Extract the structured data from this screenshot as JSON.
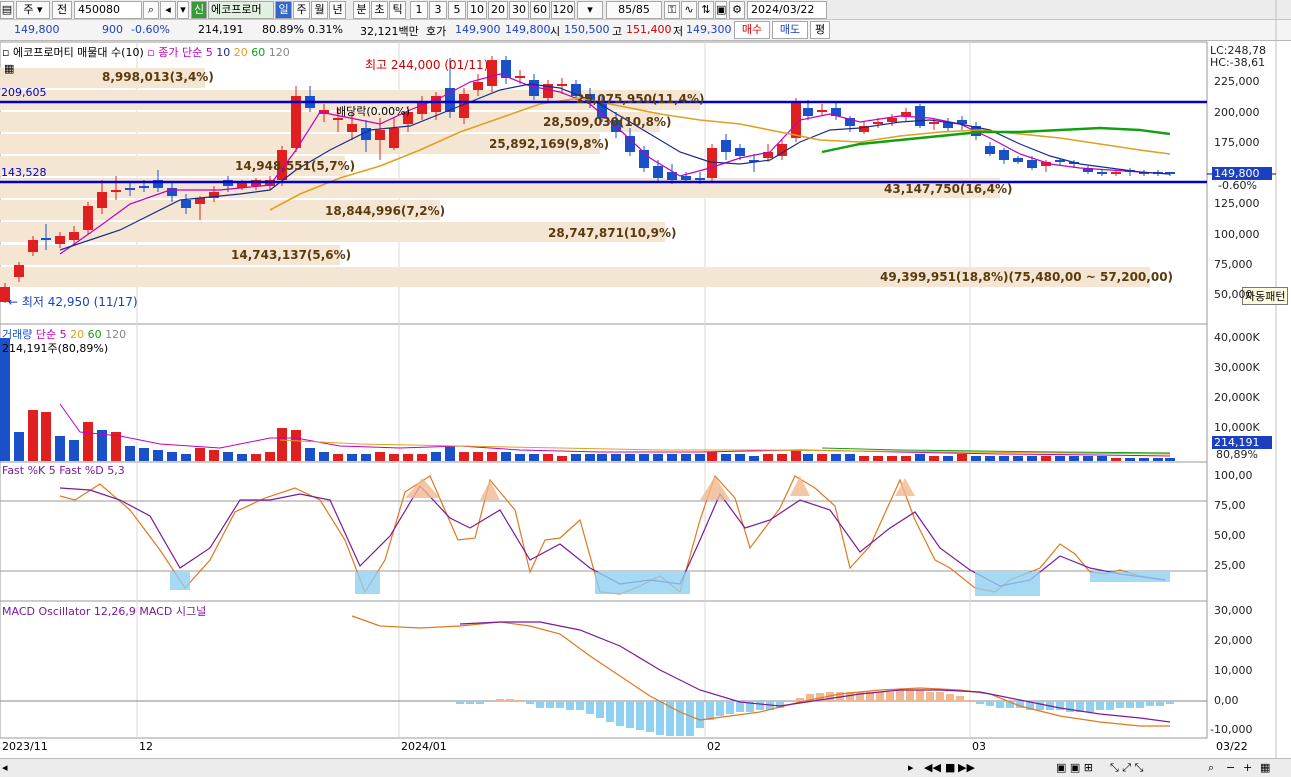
{
  "toolbar": {
    "type_select": "주",
    "side_select": "전",
    "code": "450080",
    "new_badge": "신",
    "stock_name": "에코프로머",
    "periods": [
      "일",
      "주",
      "월",
      "년",
      "분",
      "초",
      "틱"
    ],
    "selected_period": "일",
    "intervals": [
      "1",
      "3",
      "5",
      "10",
      "20",
      "30",
      "60",
      "120"
    ],
    "count": "85/85",
    "date": "2024/03/22"
  },
  "quote": {
    "price": "149,800",
    "change": "900",
    "change_pct": "-0.60%",
    "volume": "214,191",
    "vol_ratio": "80.89%",
    "turnover": "0.31%",
    "amount": "32,121백만",
    "ask_label": "호가",
    "ask": "149,900",
    "bid": "149,800",
    "open_label": "시",
    "open": "150,500",
    "high_label": "고",
    "high": "151,400",
    "low_label": "저",
    "low": "149,300",
    "buy_btn": "매수",
    "sell_btn": "매도",
    "eval_btn": "평"
  },
  "price_panel": {
    "title": "에코프로머티 매물대 수(10)",
    "ma_label": "종가 단순",
    "ma_periods": [
      "5",
      "10",
      "20",
      "60",
      "120"
    ],
    "lc": "LC:248,78",
    "hc": "HC:-38,61",
    "axis": [
      "225,000",
      "200,000",
      "175,000",
      "150,000",
      "125,000",
      "100,000",
      "75,000",
      "50,000"
    ],
    "current_price": "149,800",
    "current_pct": "-0.60%",
    "hline_high": "209,605",
    "hline_low": "143,528",
    "high_marker": "최고 244,000 (01/11)",
    "low_marker": "최저 42,950 (11/17)",
    "dividend_marker": "배당락(0.00%)",
    "auto_pattern": "자동패턴",
    "volume_profile": [
      "8,998,013(3,4%)",
      "29,075,950(11,4%)",
      "28,509,030(10,8%)",
      "25,892,169(9,8%)",
      "14,948,551(5,7%)",
      "43,147,750(16,4%)",
      "18,844,996(7,2%)",
      "28,747,871(10,9%)",
      "14,743,137(5,6%)",
      "49,399,951(18,8%)(75,480,00 ~ 57,200,00)"
    ]
  },
  "volume_panel": {
    "title": "거래량",
    "ma_label": "단순",
    "ma_periods": [
      "5",
      "20",
      "60",
      "120"
    ],
    "current": "214,191주(80,89%)",
    "axis": [
      "40,000K",
      "30,000K",
      "20,000K",
      "10,000K"
    ],
    "current_box": "214,191",
    "current_pct": "80,89%"
  },
  "stoch_panel": {
    "title": "Fast %K 5  Fast %D 5,3",
    "axis": [
      "100,00",
      "75,00",
      "50,00",
      "25,00"
    ]
  },
  "macd_panel": {
    "title": "MACD Oscillator 12,26,9  MACD  시그널",
    "axis": [
      "30,000",
      "20,000",
      "10,000",
      "0,00",
      "-10,000"
    ]
  },
  "xaxis": {
    "labels": [
      "2023/11",
      "12",
      "2024/01",
      "02",
      "03"
    ],
    "last": "03/22"
  },
  "colors": {
    "up": "#e02020",
    "down": "#1a50c8",
    "ma5": "#c000c0",
    "ma10": "#1a2a8a",
    "ma20": "#e0a020",
    "ma60": "#10a010",
    "hline": "#0000c8",
    "profile": "#f5e6d3"
  }
}
